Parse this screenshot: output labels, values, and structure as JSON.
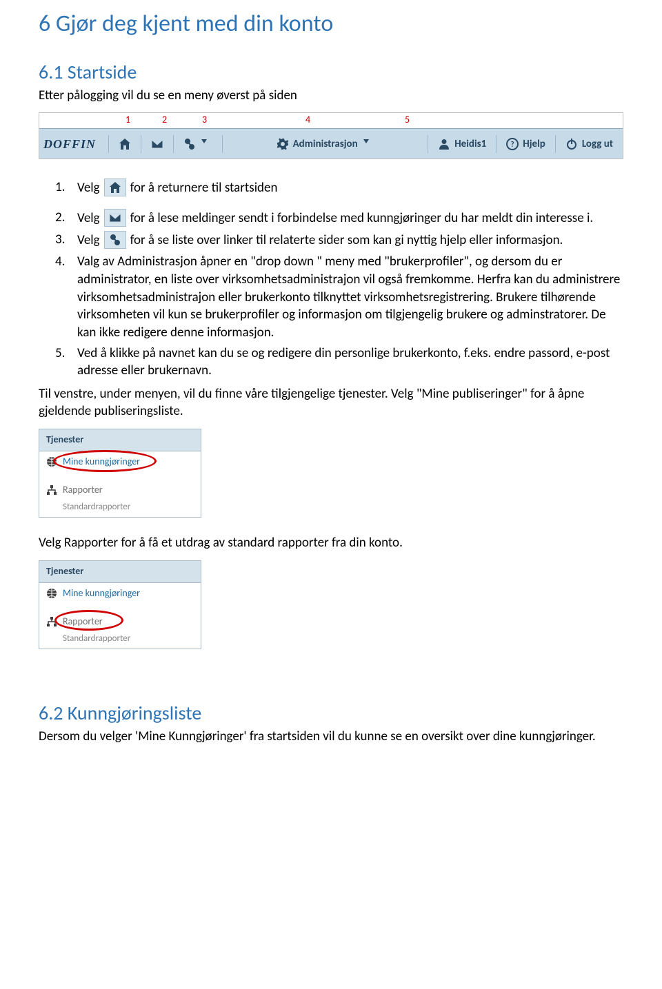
{
  "h1": "6 Gjør deg kjent med din konto",
  "h2_1": "6.1 Startside",
  "intro_1": "Etter pålogging vil du se en meny øverst på siden",
  "menu": {
    "logo": "DOFFIN",
    "nums": [
      "1",
      "2",
      "3",
      "4",
      "5"
    ],
    "items": {
      "home": "",
      "mail": "",
      "links": "",
      "admin": "Administrasjon",
      "user": "Heidis1",
      "help": "Hjelp",
      "logout": "Logg ut"
    }
  },
  "steps": {
    "s1_a": "Velg",
    "s1_b": "for å returnere til startsiden",
    "s2_a": "Velg",
    "s2_b": "for å lese meldinger sendt i forbindelse med kunngjøringer du har meldt din interesse i.",
    "s3_a": "Velg",
    "s3_b": "for å se liste over linker til relaterte sider som kan gi nyttig hjelp eller informasjon.",
    "s4": "Valg av Administrasjon åpner en \"drop down \" meny med \"brukerprofiler\", og dersom du er administrator, en liste over virksomhetsadministrajon vil også fremkomme. Herfra kan du administrere virksomhetsadministrajon eller brukerkonto tilknyttet virksomhetsregistrering. Brukere tilhørende virksomheten vil  kun se brukerprofiler og informasjon om tilgjengelig brukere og adminstratorer. De kan ikke redigere denne informasjon.",
    "s5": "Ved å klikke på navnet kan du se og redigere din personlige brukerkonto, f.eks. endre passord, e-post adresse eller brukernavn."
  },
  "para_1": "Til venstre, under menyen, vil du finne våre tilgjengelige tjenester.  Velg \"Mine publiseringer\"  for å åpne gjeldende publiseringsliste.",
  "tjen": {
    "title": "Tjenester",
    "item1": "Mine kunngjøringer",
    "item2": "Rapporter",
    "sub2": "Standardrapporter"
  },
  "para_2": "Velg  Rapporter for å få et utdrag av standard rapporter fra din konto.",
  "h2_2": "6.2 Kunngjøringsliste",
  "para_3": "Dersom du velger 'Mine Kunngjøringer' fra startsiden vil du kunne se en oversikt over dine kunngjøringer."
}
